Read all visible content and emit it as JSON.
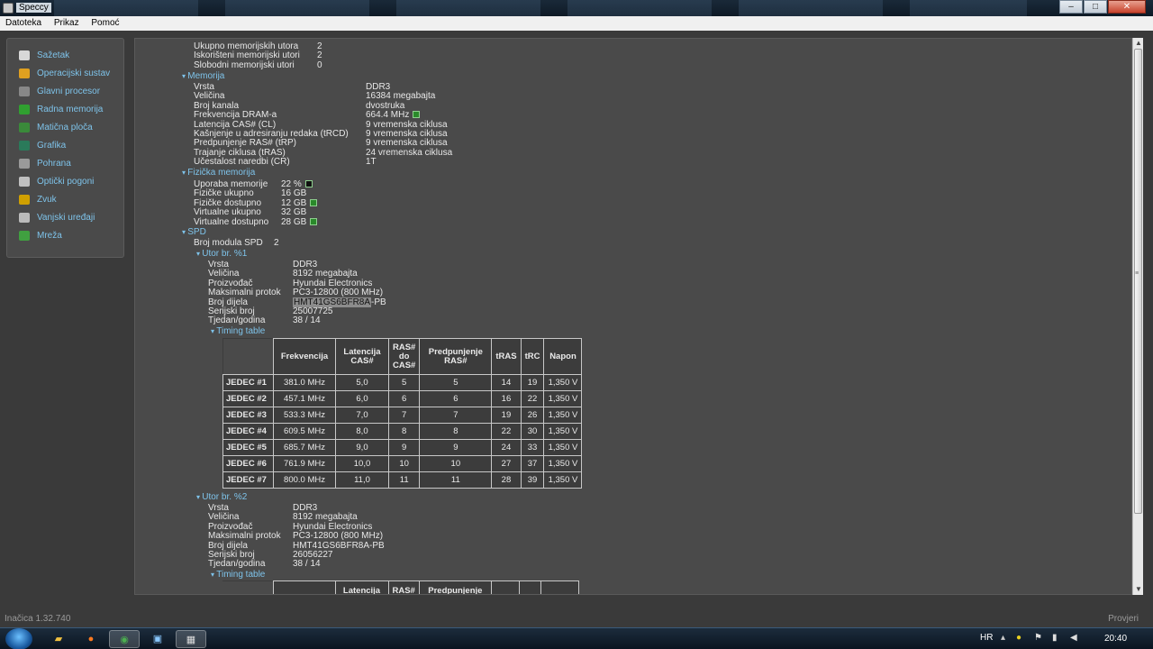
{
  "window": {
    "title": "Speccy",
    "minimize": "–",
    "maximize": "□",
    "close": "✕"
  },
  "menu": [
    "Datoteka",
    "Prikaz",
    "Pomoć"
  ],
  "sidebar": [
    {
      "label": "Sažetak",
      "icon": "summary-icon",
      "color": "#d8d8d8"
    },
    {
      "label": "Operacijski sustav",
      "icon": "windows-icon",
      "color": "#e0a020"
    },
    {
      "label": "Glavni procesor",
      "icon": "cpu-icon",
      "color": "#888888"
    },
    {
      "label": "Radna memorija",
      "icon": "ram-icon",
      "color": "#30a030"
    },
    {
      "label": "Matična ploča",
      "icon": "motherboard-icon",
      "color": "#3a8a3a"
    },
    {
      "label": "Grafika",
      "icon": "graphics-icon",
      "color": "#2a7a5a"
    },
    {
      "label": "Pohrana",
      "icon": "storage-icon",
      "color": "#9a9a9a"
    },
    {
      "label": "Optički pogoni",
      "icon": "optical-drive-icon",
      "color": "#c0c0c0"
    },
    {
      "label": "Zvuk",
      "icon": "sound-icon",
      "color": "#d0a000"
    },
    {
      "label": "Vanjski uređaji",
      "icon": "peripherals-icon",
      "color": "#bbbbbb"
    },
    {
      "label": "Mreža",
      "icon": "network-icon",
      "color": "#40a040"
    }
  ],
  "slots": [
    {
      "k": "Ukupno memorijskih utora",
      "v": "2"
    },
    {
      "k": "Iskorišteni memorijski utori",
      "v": "2"
    },
    {
      "k": "Slobodni memorijski utori",
      "v": "0"
    }
  ],
  "memory": {
    "title": "Memorija",
    "rows": [
      {
        "k": "Vrsta",
        "v": "DDR3"
      },
      {
        "k": "Veličina",
        "v": "16384 megabajta"
      },
      {
        "k": "Broj kanala",
        "v": "dvostruka"
      },
      {
        "k": "Frekvencija DRAM-a",
        "v": "664.4 MHz"
      },
      {
        "k": "Latencija CAS# (CL)",
        "v": "9 vremenska ciklusa"
      },
      {
        "k": "Kašnjenje u adresiranju redaka (tRCD)",
        "v": "9 vremenska ciklusa"
      },
      {
        "k": "Predpunjenje RAS# (tRP)",
        "v": "9 vremenska ciklusa"
      },
      {
        "k": "Trajanje ciklusa (tRAS)",
        "v": "24 vremenska ciklusa"
      },
      {
        "k": "Učestalost naredbi (CR)",
        "v": "1T"
      }
    ]
  },
  "physical": {
    "title": "Fizička memorija",
    "rows": [
      {
        "k": "Uporaba memorije",
        "v": "22 %"
      },
      {
        "k": "Fizičke ukupno",
        "v": "16 GB"
      },
      {
        "k": "Fizičke dostupno",
        "v": "12 GB"
      },
      {
        "k": "Virtualne ukupno",
        "v": "32 GB"
      },
      {
        "k": "Virtualne dostupno",
        "v": "28 GB"
      }
    ]
  },
  "spd": {
    "title": "SPD",
    "modules_label": "Broj modula SPD",
    "modules_value": "2",
    "slot1": {
      "title": "Utor br. %1",
      "rows": [
        {
          "k": "Vrsta",
          "v": "DDR3"
        },
        {
          "k": "Veličina",
          "v": "8192 megabajta"
        },
        {
          "k": "Proizvođač",
          "v": "Hyundai Electronics"
        },
        {
          "k": "Maksimalni protok",
          "v": "PC3-12800 (800 MHz)"
        },
        {
          "k": "Broj dijela",
          "v_sel": "HMT41GS6BFR8A",
          "v_rest": "-PB"
        },
        {
          "k": "Serijski broj",
          "v": "25007725"
        },
        {
          "k": "Tjedan/godina",
          "v": "38 / 14"
        }
      ],
      "timing_title": "Timing table"
    },
    "slot2": {
      "title": "Utor br. %2",
      "rows": [
        {
          "k": "Vrsta",
          "v": "DDR3"
        },
        {
          "k": "Veličina",
          "v": "8192 megabajta"
        },
        {
          "k": "Proizvođač",
          "v": "Hyundai Electronics"
        },
        {
          "k": "Maksimalni protok",
          "v": "PC3-12800 (800 MHz)"
        },
        {
          "k": "Broj dijela",
          "v": "HMT41GS6BFR8A-PB"
        },
        {
          "k": "Serijski broj",
          "v": "26056227"
        },
        {
          "k": "Tjedan/godina",
          "v": "38 / 14"
        }
      ],
      "timing_title": "Timing table"
    }
  },
  "timing_table": {
    "headers": [
      "Frekvencija",
      "Latencija CAS#",
      "RAS# do CAS#",
      "Predpunjenje RAS#",
      "tRAS",
      "tRC",
      "Napon"
    ],
    "partial_headers": [
      "Latencija",
      "RAS#",
      "Predpunjenje"
    ],
    "rows": [
      {
        "name": "JEDEC #1",
        "cells": [
          "381.0 MHz",
          "5,0",
          "5",
          "5",
          "14",
          "19",
          "1,350 V"
        ]
      },
      {
        "name": "JEDEC #2",
        "cells": [
          "457.1 MHz",
          "6,0",
          "6",
          "6",
          "16",
          "22",
          "1,350 V"
        ]
      },
      {
        "name": "JEDEC #3",
        "cells": [
          "533.3 MHz",
          "7,0",
          "7",
          "7",
          "19",
          "26",
          "1,350 V"
        ]
      },
      {
        "name": "JEDEC #4",
        "cells": [
          "609.5 MHz",
          "8,0",
          "8",
          "8",
          "22",
          "30",
          "1,350 V"
        ]
      },
      {
        "name": "JEDEC #5",
        "cells": [
          "685.7 MHz",
          "9,0",
          "9",
          "9",
          "24",
          "33",
          "1,350 V"
        ]
      },
      {
        "name": "JEDEC #6",
        "cells": [
          "761.9 MHz",
          "10,0",
          "10",
          "10",
          "27",
          "37",
          "1,350 V"
        ]
      },
      {
        "name": "JEDEC #7",
        "cells": [
          "800.0 MHz",
          "11,0",
          "11",
          "11",
          "28",
          "39",
          "1,350 V"
        ]
      }
    ]
  },
  "status": {
    "version": "Inačica 1.32.740",
    "check": "Provjeri"
  },
  "taskbar": {
    "lang": "HR",
    "clock": "20:40"
  }
}
